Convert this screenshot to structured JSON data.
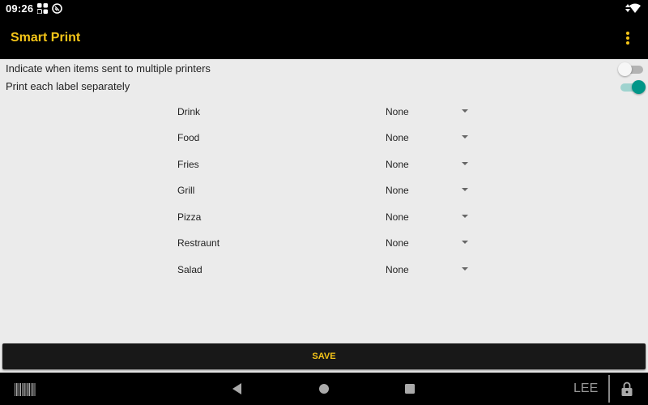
{
  "status_bar": {
    "time": "09:26",
    "icons": [
      "app-grid-icon",
      "sync-icon",
      "data-arrows-icon",
      "wifi-icon"
    ]
  },
  "app_bar": {
    "title": "Smart Print",
    "menu_icon": "more-vert-icon"
  },
  "settings": [
    {
      "label": "Indicate when items sent to multiple printers",
      "enabled": false
    },
    {
      "label": "Print each label separately",
      "enabled": true
    }
  ],
  "printer_assignments": [
    {
      "category": "Drink",
      "printer": "None"
    },
    {
      "category": "Food",
      "printer": "None"
    },
    {
      "category": "Fries",
      "printer": "None"
    },
    {
      "category": "Grill",
      "printer": "None"
    },
    {
      "category": "Pizza",
      "printer": "None"
    },
    {
      "category": "Restraunt",
      "printer": "None"
    },
    {
      "category": "Salad",
      "printer": "None"
    }
  ],
  "save_button": {
    "label": "SAVE"
  },
  "nav_bar": {
    "user": "LEE",
    "icons": [
      "barcode-icon",
      "back-icon",
      "home-icon",
      "recents-icon",
      "lock-icon"
    ]
  },
  "colors": {
    "accent": "#f5c518",
    "toggle_on": "#009688",
    "background": "#ebebeb",
    "bar": "#000000"
  }
}
